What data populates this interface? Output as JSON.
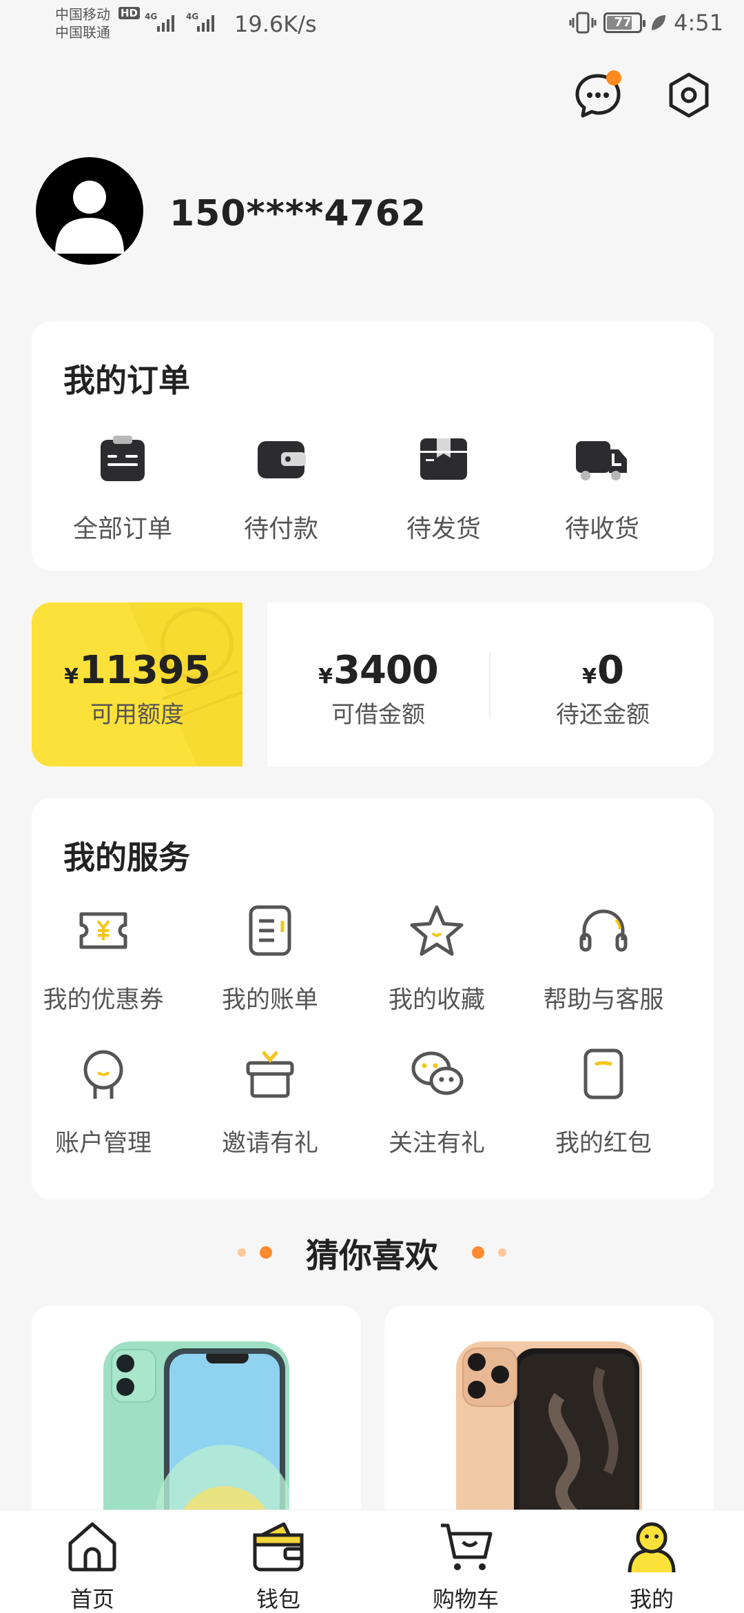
{
  "status_bar": {
    "carrier1": "中国移动",
    "carrier2": "中国联通",
    "hd_badge": "HD",
    "network1": "4G",
    "network2": "4G",
    "speed": "19.6K/s",
    "battery": "77",
    "battery_fraction": 0.77,
    "time": "4:51"
  },
  "header": {
    "message_icon": "chat-bubble-icon",
    "settings_icon": "settings-hexagon-icon",
    "has_unread": true
  },
  "profile": {
    "avatar_icon": "user-avatar-icon",
    "phone": "150****4762"
  },
  "orders": {
    "title": "我的订单",
    "items": [
      {
        "label": "全部订单",
        "icon": "clipboard-icon"
      },
      {
        "label": "待付款",
        "icon": "wallet-icon"
      },
      {
        "label": "待发货",
        "icon": "package-icon"
      },
      {
        "label": "待收货",
        "icon": "delivery-truck-icon"
      }
    ]
  },
  "credit": {
    "currency": "¥",
    "available": {
      "value": "11395",
      "label": "可用额度"
    },
    "borrowable": {
      "value": "3400",
      "label": "可借金额"
    },
    "to_repay": {
      "value": "0",
      "label": "待还金额"
    }
  },
  "services": {
    "title": "我的服务",
    "items": [
      {
        "label": "我的优惠券",
        "icon": "coupon-icon"
      },
      {
        "label": "我的账单",
        "icon": "bill-icon"
      },
      {
        "label": "我的收藏",
        "icon": "star-icon"
      },
      {
        "label": "帮助与客服",
        "icon": "headset-icon"
      },
      {
        "label": "账户管理",
        "icon": "account-icon"
      },
      {
        "label": "邀请有礼",
        "icon": "gift-icon"
      },
      {
        "label": "关注有礼",
        "icon": "wechat-icon"
      },
      {
        "label": "我的红包",
        "icon": "red-packet-icon"
      }
    ]
  },
  "recommend": {
    "title": "猜你喜欢",
    "products": [
      {
        "image": "phone-green-image"
      },
      {
        "image": "phone-gold-image"
      }
    ]
  },
  "tabbar": {
    "items": [
      {
        "label": "首页",
        "icon": "home-icon"
      },
      {
        "label": "钱包",
        "icon": "wallet-icon"
      },
      {
        "label": "购物车",
        "icon": "cart-icon"
      },
      {
        "label": "我的",
        "icon": "profile-icon"
      }
    ],
    "active_index": 3
  },
  "colors": {
    "accent_yellow": "#fce13a",
    "accent_orange": "#ff8a1e",
    "background": "#f6f6f6"
  }
}
